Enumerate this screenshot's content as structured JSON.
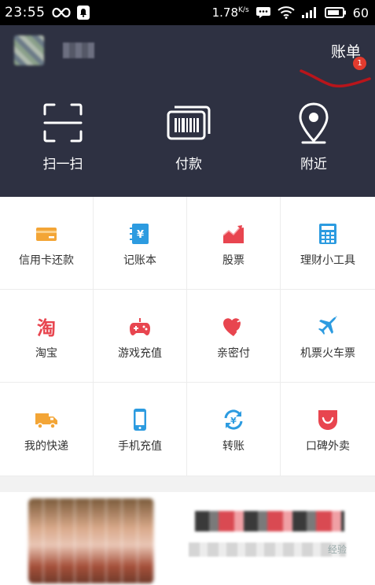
{
  "status_bar": {
    "time": "23:55",
    "network_speed": "1.78",
    "network_unit": "K/s",
    "battery": "60"
  },
  "header": {
    "bill_label": "账单",
    "bill_badge": "1",
    "quick_actions": [
      {
        "label": "扫一扫",
        "icon": "scan-icon"
      },
      {
        "label": "付款",
        "icon": "barcode-icon"
      },
      {
        "label": "附近",
        "icon": "location-pin-icon"
      }
    ]
  },
  "grid": [
    {
      "label": "信用卡还款",
      "icon": "credit-card-icon",
      "color": "#f3a536"
    },
    {
      "label": "记账本",
      "icon": "account-book-icon",
      "color": "#2c9be0"
    },
    {
      "label": "股票",
      "icon": "stock-chart-icon",
      "color": "#e8454f"
    },
    {
      "label": "理财小工具",
      "icon": "calculator-icon",
      "color": "#2c9be0"
    },
    {
      "label": "淘宝",
      "icon": "taobao-icon",
      "color": "#e8454f"
    },
    {
      "label": "游戏充值",
      "icon": "gamepad-icon",
      "color": "#e8454f"
    },
    {
      "label": "亲密付",
      "icon": "hearts-icon",
      "color": "#e8454f"
    },
    {
      "label": "机票火车票",
      "icon": "airplane-icon",
      "color": "#2c9be0"
    },
    {
      "label": "我的快递",
      "icon": "delivery-truck-icon",
      "color": "#f3a536"
    },
    {
      "label": "手机充值",
      "icon": "mobile-phone-icon",
      "color": "#2c9be0"
    },
    {
      "label": "转账",
      "icon": "transfer-icon",
      "color": "#2c9be0"
    },
    {
      "label": "口碑外卖",
      "icon": "koubei-takeout-icon",
      "color": "#e8454f"
    }
  ],
  "watermark": "经验"
}
